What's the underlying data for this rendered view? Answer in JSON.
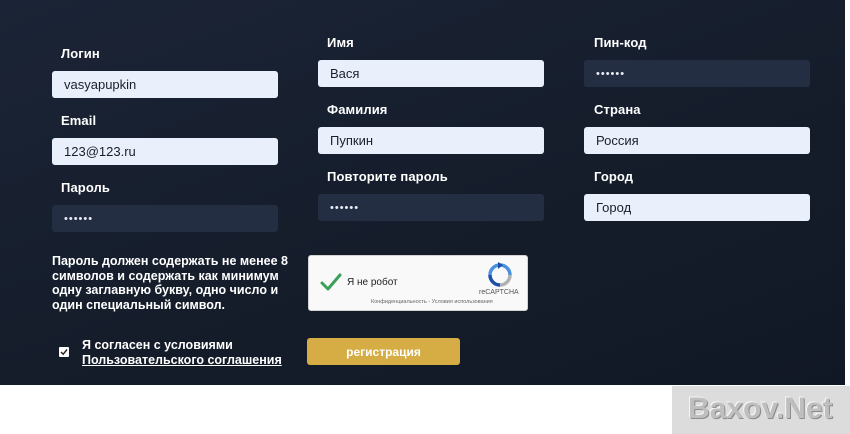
{
  "form": {
    "login": {
      "label": "Логин",
      "value": "vasyapupkin"
    },
    "email": {
      "label": "Email",
      "value": "123@123.ru"
    },
    "password": {
      "label": "Пароль",
      "value": "••••••"
    },
    "first_name": {
      "label": "Имя",
      "value": "Вася"
    },
    "last_name": {
      "label": "Фамилия",
      "value": "Пупкин"
    },
    "password_repeat": {
      "label": "Повторите пароль",
      "value": "••••••"
    },
    "pin": {
      "label": "Пин-код",
      "value": "••••••"
    },
    "country": {
      "label": "Страна",
      "value": "Россия"
    },
    "city": {
      "label": "Город",
      "value": "Город"
    },
    "password_hint": "Пароль должен содержать не менее 8 символов и содержать как минимум одну заглавную букву, одно число и один специальный символ.",
    "agree_text": "Я согласен с условиями",
    "agree_link": "Пользовательского соглашения",
    "agree_checked": true,
    "submit_label": "регистрация"
  },
  "captcha": {
    "label": "Я не робот",
    "brand": "reCAPTCHA",
    "legal": "Конфиденциальность - Условия использования",
    "checked": true
  },
  "watermark": "Baxov.Net",
  "colors": {
    "background": "#151d2b",
    "field_light": "#e9effb",
    "field_dark": "#232e43",
    "button": "#d6ad45",
    "check": "#3aa157"
  }
}
